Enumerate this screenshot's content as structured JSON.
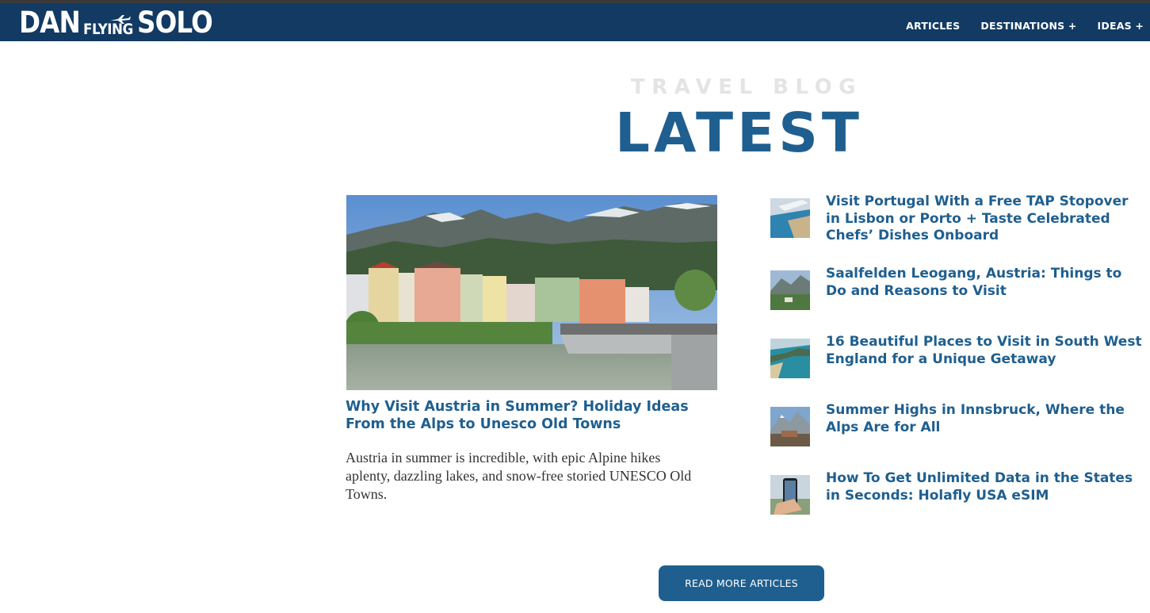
{
  "header": {
    "logo": {
      "part1": "DAN",
      "part2": "FLYING",
      "part3": "SOLO"
    },
    "nav": [
      {
        "label": "ARTICLES"
      },
      {
        "label": "DESTINATIONS +"
      },
      {
        "label": "IDEAS +"
      }
    ],
    "colors": {
      "nav_bg": "#123a63"
    }
  },
  "section": {
    "kicker": "TRAVEL BLOG",
    "title": "LATEST"
  },
  "featured": {
    "title": "Why Visit Austria in Summer? Holiday Ideas From the Alps to Unesco Old Towns",
    "excerpt": "Austria in summer is incredible, with epic Alpine hikes aplenty, dazzling lakes, and snow-free storied UNESCO Old Towns."
  },
  "sidebar": {
    "items": [
      {
        "title": "Visit Portugal With a Free TAP Stopover in Lisbon or Porto + Taste Celebrated Chefs’ Dishes Onboard"
      },
      {
        "title": "Saalfelden Leogang, Austria: Things to Do and Reasons to Visit"
      },
      {
        "title": "16 Beautiful Places to Visit in South West England for a Unique Getaway"
      },
      {
        "title": "Summer Highs in Innsbruck, Where the Alps Are for All"
      },
      {
        "title": "How To Get Unlimited Data in the States in Seconds: Holafly USA eSIM"
      }
    ]
  },
  "cta": {
    "label": "READ MORE ARTICLES"
  },
  "colors": {
    "accent": "#1f5f8f",
    "kicker": "#e4e4e4"
  }
}
